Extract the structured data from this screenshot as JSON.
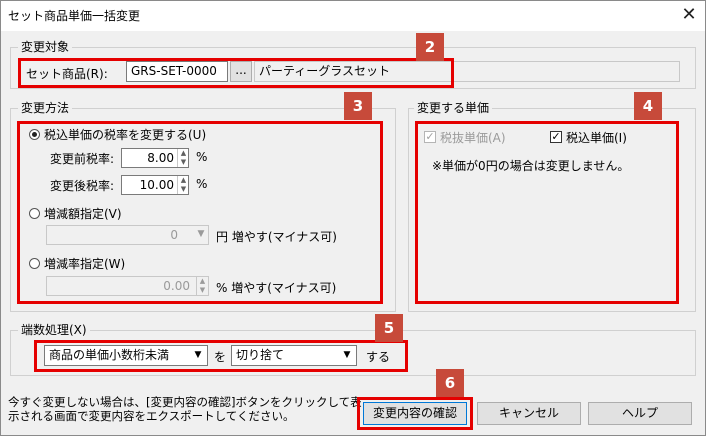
{
  "window": {
    "title": "セット商品単価一括変更",
    "close_label": "✕"
  },
  "target_group": {
    "label": "変更対象",
    "field_label": "セット商品(R):",
    "code_value": "GRS-SET-0000",
    "browse_label": "...",
    "name_value": "パーティーグラスセット",
    "badge": "2"
  },
  "method_group": {
    "label": "変更方法",
    "badge": "3",
    "option_tax_rate": "税込単価の税率を変更する(U)",
    "before_rate_label": "変更前税率:",
    "before_rate_value": "8.00",
    "after_rate_label": "変更後税率:",
    "after_rate_value": "10.00",
    "percent_unit": "%",
    "option_amount": "増減額指定(V)",
    "amount_value": "0",
    "amount_suffix": "円 増やす(マイナス可)",
    "option_rate": "増減率指定(W)",
    "rate_value": "0.00",
    "rate_suffix": "% 増やす(マイナス可)"
  },
  "price_group": {
    "label": "変更する単価",
    "badge": "4",
    "check_excl_label": "税抜単価(A)",
    "check_incl_label": "税込単価(I)",
    "note": "※単価が0円の場合は変更しません。"
  },
  "rounding_group": {
    "label": "端数処理(X)",
    "badge": "5",
    "target_select": "商品の単価小数桁未満",
    "particle_wo": "を",
    "method_select": "切り捨て",
    "suffix": "する"
  },
  "footer": {
    "hint_line1": "今すぐ変更しない場合は、[変更内容の確認]ボタンをクリックして表",
    "hint_line2": "示される画面で変更内容をエクスポートしてください。",
    "confirm_label": "変更内容の確認",
    "cancel_label": "キャンセル",
    "help_label": "ヘルプ",
    "badge": "6"
  },
  "colors": {
    "highlight": "#e50000",
    "badge_bg": "#c74a3a",
    "dialog_bg": "#f0f0f0"
  }
}
